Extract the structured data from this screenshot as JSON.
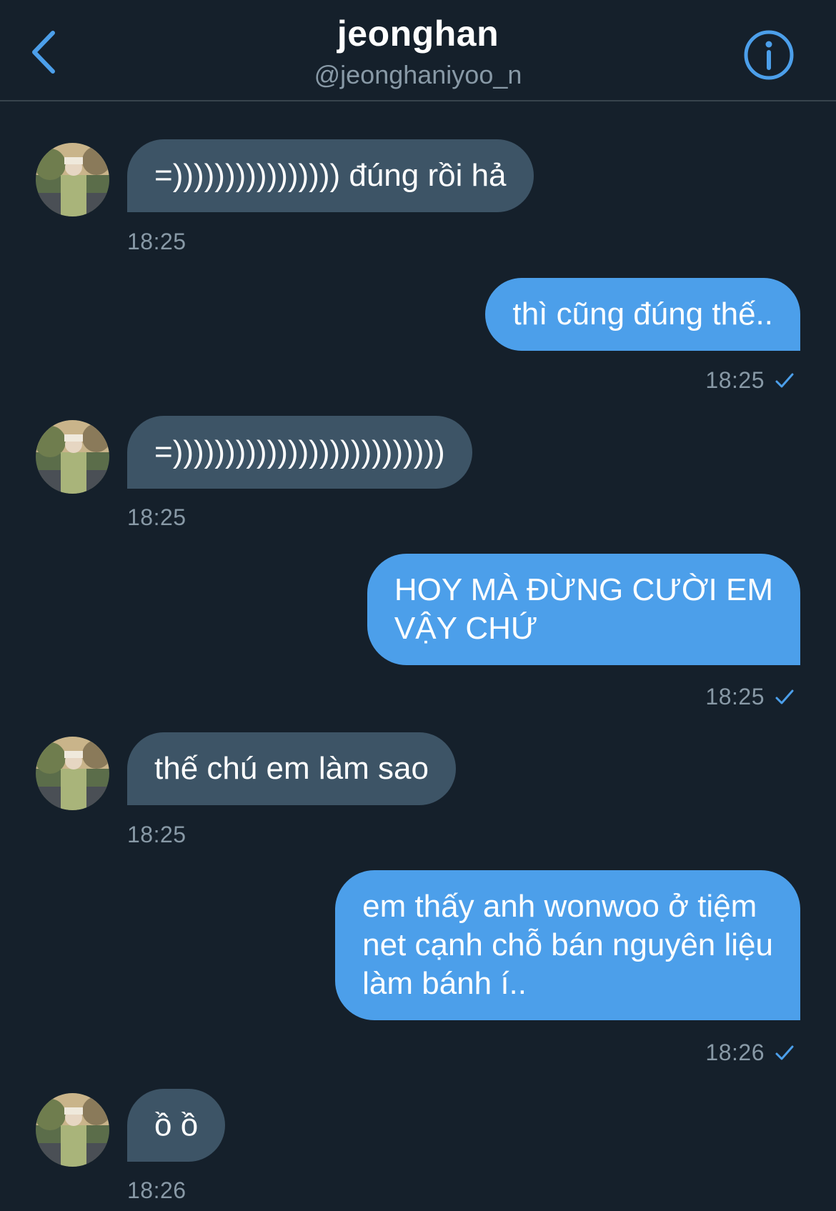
{
  "header": {
    "title": "jeonghan",
    "handle": "@jeonghaniyoo_n",
    "back_icon": "chevron-left-icon",
    "info_icon": "info-circle-icon"
  },
  "colors": {
    "background": "#15202b",
    "incoming_bubble": "#3d5466",
    "outgoing_bubble": "#4c9fea",
    "accent": "#4c9fea",
    "muted_text": "#8899a6"
  },
  "messages": [
    {
      "direction": "incoming",
      "text": "=)))))))))))))))) đúng rồi hả",
      "time": "18:25"
    },
    {
      "direction": "outgoing",
      "text": "thì cũng đúng thế..",
      "time": "18:25",
      "read": true
    },
    {
      "direction": "incoming",
      "text": "=))))))))))))))))))))))))))",
      "time": "18:25"
    },
    {
      "direction": "outgoing",
      "text": "HOY MÀ ĐỪNG CƯỜI EM\nVẬY CHỨ",
      "time": "18:25",
      "read": true
    },
    {
      "direction": "incoming",
      "text": "thế chú em làm sao",
      "time": "18:25"
    },
    {
      "direction": "outgoing",
      "text": "em thấy anh wonwoo ở tiệm\nnet cạnh chỗ bán nguyên liệu\nlàm bánh í..",
      "time": "18:26",
      "read": true
    },
    {
      "direction": "incoming",
      "text": "ồ ồ",
      "time": "18:26"
    }
  ]
}
